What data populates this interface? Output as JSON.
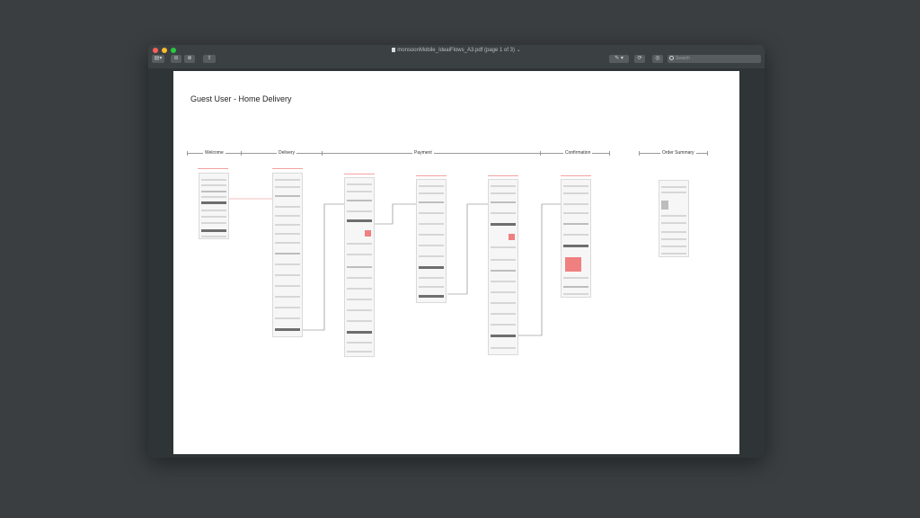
{
  "window": {
    "title": "monsoonMobile_IdealFlows_A3.pdf (page 1 of 3)",
    "search_placeholder": "Search"
  },
  "document": {
    "heading": "Guest User - Home Delivery",
    "phases": [
      "Welcome",
      "Delivery",
      "Payment",
      "Confirmation",
      "Order Summary"
    ]
  },
  "colors": {
    "desktop": "#3a3e40",
    "window": "#2f3536",
    "accent_red": "#f08080",
    "traffic_close": "#fc5f57",
    "traffic_min": "#fdbc2e",
    "traffic_max": "#28c840"
  },
  "icons": {
    "sidebar_toggle": "sidebar-icon",
    "zoom_out": "zoom-out-icon",
    "zoom_in": "zoom-in-icon",
    "share": "share-icon",
    "markup": "pen-icon",
    "rotate": "rotate-icon",
    "annotate": "annotate-icon",
    "search": "magnifier-icon"
  }
}
